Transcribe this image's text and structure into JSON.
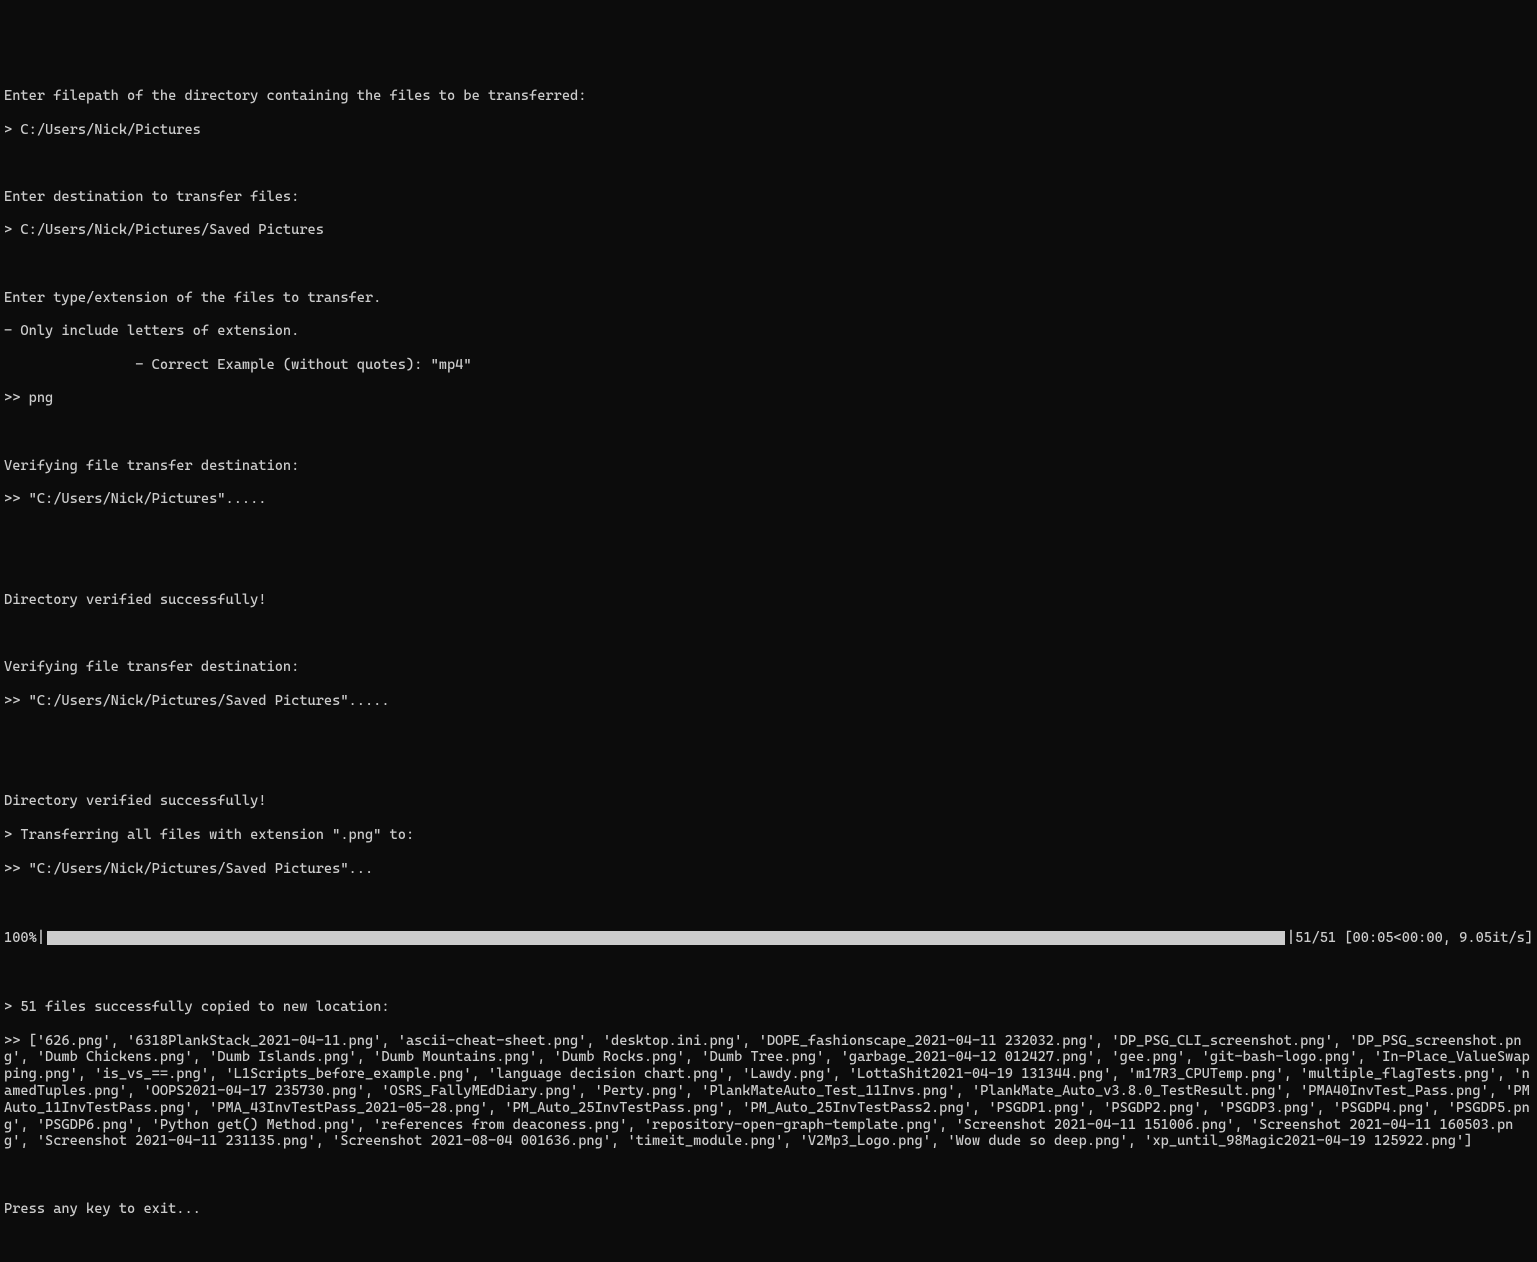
{
  "prompts": {
    "source_prompt": "Enter filepath of the directory containing the files to be transferred:",
    "source_input": "> C:/Users/Nick/Pictures",
    "dest_prompt": "Enter destination to transfer files:",
    "dest_input": "> C:/Users/Nick/Pictures/Saved Pictures",
    "ext_prompt_1": "Enter type/extension of the files to transfer.",
    "ext_prompt_2": "- Only include letters of extension.",
    "ext_prompt_3": "                - Correct Example (without quotes): \"mp4\"",
    "ext_input": ">> png"
  },
  "verification": {
    "verify_1": "Verifying file transfer destination:",
    "verify_1_path": ">> \"C:/Users/Nick/Pictures\".....",
    "verify_1_success": "Directory verified successfully!",
    "verify_2": "Verifying file transfer destination:",
    "verify_2_path": ">> \"C:/Users/Nick/Pictures/Saved Pictures\".....",
    "verify_2_success": "Directory verified successfully!",
    "transfer_msg": "> Transferring all files with extension \".png\" to:",
    "transfer_dest": ">> \"C:/Users/Nick/Pictures/Saved Pictures\"..."
  },
  "progress": {
    "percent": "100%",
    "pipe_start": "|",
    "pipe_end": "|",
    "stats": " 51/51 [00:05<00:00,  9.05it/s]"
  },
  "results": {
    "success_msg": "> 51 files successfully copied to new location:",
    "file_list": ">> ['626.png', '6318PlankStack_2021-04-11.png', 'ascii-cheat-sheet.png', 'desktop.ini.png', 'DOPE_fashionscape_2021-04-11 232032.png', 'DP_PSG_CLI_screenshot.png', 'DP_PSG_screenshot.png', 'Dumb Chickens.png', 'Dumb Islands.png', 'Dumb Mountains.png', 'Dumb Rocks.png', 'Dumb Tree.png', 'garbage_2021-04-12 012427.png', 'gee.png', 'git-bash-logo.png', 'In-Place_ValueSwapping.png', 'is_vs_==.png', 'L1Scripts_before_example.png', 'language decision chart.png', 'Lawdy.png', 'LottaShit2021-04-19 131344.png', 'm17R3_CPUTemp.png', 'multiple_flagTests.png', 'namedTuples.png', 'OOPS2021-04-17 235730.png', 'OSRS_FallyMEdDiary.png', 'Perty.png', 'PlankMateAuto_Test_11Invs.png', 'PlankMate_Auto_v3.8.0_TestResult.png', 'PMA40InvTest_Pass.png', 'PMAuto_11InvTestPass.png', 'PMA_43InvTestPass_2021-05-28.png', 'PM_Auto_25InvTestPass.png', 'PM_Auto_25InvTestPass2.png', 'PSGDP1.png', 'PSGDP2.png', 'PSGDP3.png', 'PSGDP4.png', 'PSGDP5.png', 'PSGDP6.png', 'Python get() Method.png', 'references from deaconess.png', 'repository-open-graph-template.png', 'Screenshot 2021-04-11 151006.png', 'Screenshot 2021-04-11 160503.png', 'Screenshot 2021-04-11 231135.png', 'Screenshot 2021-08-04 001636.png', 'timeit_module.png', 'V2Mp3_Logo.png', 'Wow dude so deep.png', 'xp_until_98Magic2021-04-19 125922.png']",
    "exit_prompt": "Press any key to exit..."
  }
}
